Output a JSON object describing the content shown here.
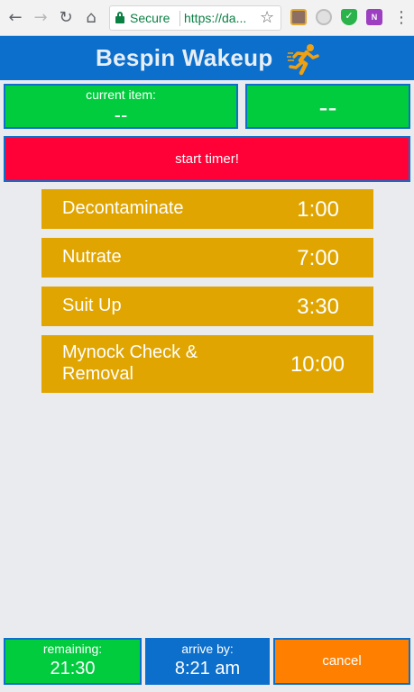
{
  "browser": {
    "secure_label": "Secure",
    "url": "https://da...",
    "back_icon": "←",
    "forward_icon": "→",
    "reload_icon": "↻",
    "home_icon": "⌂",
    "star_icon": "☆",
    "menu_icon": "⋮",
    "onenote_label": "N"
  },
  "app": {
    "title": "Bespin Wakeup",
    "accent_color": "#0d6fcc"
  },
  "current": {
    "label": "current item:",
    "value": "--",
    "time": "--"
  },
  "start_button": "start timer!",
  "tasks": [
    {
      "name": "Decontaminate",
      "time": "1:00"
    },
    {
      "name": "Nutrate",
      "time": "7:00"
    },
    {
      "name": "Suit Up",
      "time": "3:30"
    },
    {
      "name": "Mynock Check &\nRemoval",
      "time": "10:00"
    }
  ],
  "footer": {
    "remaining_label": "remaining:",
    "remaining_value": "21:30",
    "arrive_label": "arrive by:",
    "arrive_value": "8:21 am",
    "cancel_label": "cancel"
  },
  "colors": {
    "green": "#00cc3d",
    "red": "#ff0037",
    "gold": "#e0a500",
    "orange": "#ff8000",
    "blue": "#0d6fcc"
  }
}
